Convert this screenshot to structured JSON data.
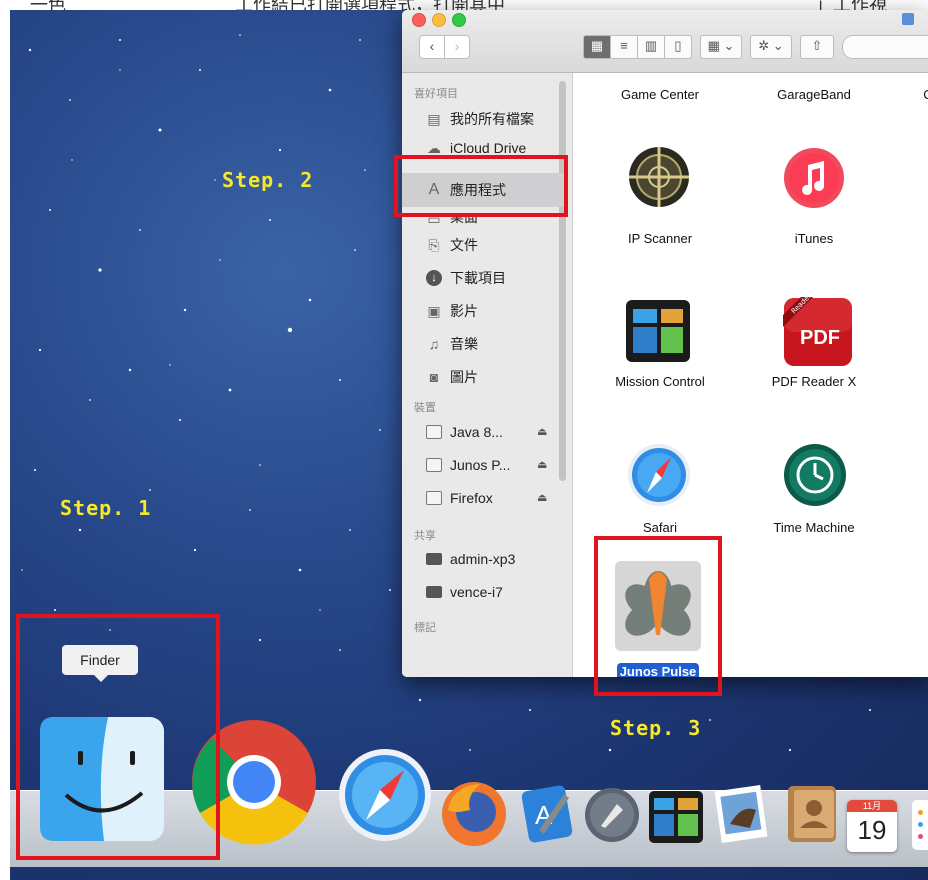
{
  "top_strip": {
    "left_text": "一色",
    "mid_text": "工作結已打開選項程式，打開其中",
    "right_text": "」工作視"
  },
  "steps": {
    "step1": "Step. 1",
    "step2": "Step. 2",
    "step3": "Step. 3"
  },
  "window": {
    "nav_back": "‹",
    "nav_forward": "›",
    "toolbar": {
      "view_icons": "▦",
      "view_list": "≡",
      "view_columns": "▥",
      "view_coverflow": "▯",
      "arrange": "▦ ⌄",
      "action": "✲ ⌄",
      "share": "⇧"
    },
    "sidebar": {
      "favorites_header": "喜好項目",
      "favorites": [
        {
          "label": "我的所有檔案",
          "icon": "all-files-icon"
        },
        {
          "label": "iCloud Drive",
          "icon": "icloud-icon"
        },
        {
          "label": "應用程式",
          "icon": "applications-icon"
        },
        {
          "label": "桌面",
          "icon": "desktop-icon"
        },
        {
          "label": "文件",
          "icon": "documents-icon"
        },
        {
          "label": "下載項目",
          "icon": "downloads-icon"
        },
        {
          "label": "影片",
          "icon": "movies-icon"
        },
        {
          "label": "音樂",
          "icon": "music-icon"
        },
        {
          "label": "圖片",
          "icon": "pictures-icon"
        }
      ],
      "devices_header": "裝置",
      "devices": [
        {
          "label": "Java 8...",
          "eject": "⏏"
        },
        {
          "label": "Junos P...",
          "eject": "⏏"
        },
        {
          "label": "Firefox",
          "eject": "⏏"
        }
      ],
      "shared_header": "共享",
      "shared": [
        {
          "label": "admin-xp3"
        },
        {
          "label": "vence-i7"
        }
      ],
      "tags_header": "標記"
    },
    "apps_header_row": [
      "Game Center",
      "GarageBand",
      "C"
    ],
    "apps": [
      {
        "label": "IP Scanner",
        "icon": "ip-scanner-icon"
      },
      {
        "label": "iTunes",
        "icon": "itunes-icon"
      },
      {
        "label": "Mission Control",
        "icon": "mission-control-icon"
      },
      {
        "label": "PDF Reader X",
        "icon": "pdf-reader-icon",
        "badge": "PDF",
        "ribbon": "Reader"
      },
      {
        "label": "Safari",
        "icon": "safari-icon"
      },
      {
        "label": "Time Machine",
        "icon": "time-machine-icon"
      },
      {
        "label": "Junos Pulse",
        "icon": "junos-pulse-icon",
        "selected": true
      }
    ]
  },
  "dock": {
    "tooltip": "Finder",
    "apps": [
      "finder-icon",
      "chrome-icon",
      "safari-icon",
      "firefox-icon",
      "xcode-icon",
      "launchpad-icon",
      "mission-control-icon",
      "preview-icon",
      "contacts-icon",
      "calendar-icon",
      "reminders-icon"
    ],
    "calendar": {
      "month": "11月",
      "day": "19"
    }
  },
  "colors": {
    "highlight_red": "#e0141e",
    "step_yellow": "#f5e92a",
    "selection_blue": "#1f5fd1"
  }
}
